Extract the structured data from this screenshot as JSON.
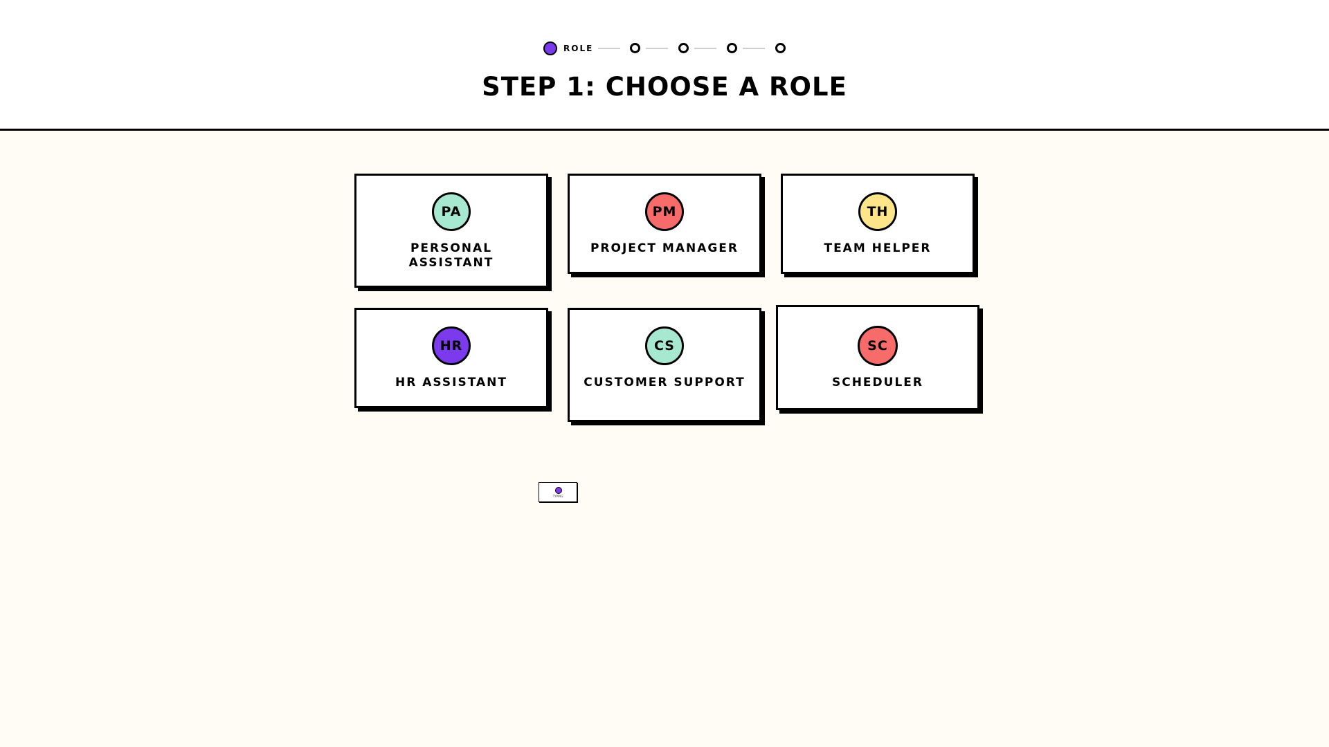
{
  "stepper": {
    "current_step_label": "ROLE",
    "total_steps": 5,
    "current_step": 1,
    "active_color": "#7c3aed"
  },
  "page": {
    "title": "STEP 1: CHOOSE A ROLE"
  },
  "roles": [
    {
      "initials": "PA",
      "label": "PERSONAL ASSISTANT",
      "color": "#a7e8d0"
    },
    {
      "initials": "PM",
      "label": "PROJECT MANAGER",
      "color": "#f76b6b"
    },
    {
      "initials": "TH",
      "label": "TEAM HELPER",
      "color": "#fde68a"
    },
    {
      "initials": "HR",
      "label": "HR ASSISTANT",
      "color": "#7c3aed"
    },
    {
      "initials": "CS",
      "label": "CUSTOMER SUPPORT",
      "color": "#a7e8d0"
    },
    {
      "initials": "SC",
      "label": "SCHEDULER",
      "color": "#f76b6b"
    }
  ],
  "mini_widget": {
    "text": "TYPING"
  }
}
